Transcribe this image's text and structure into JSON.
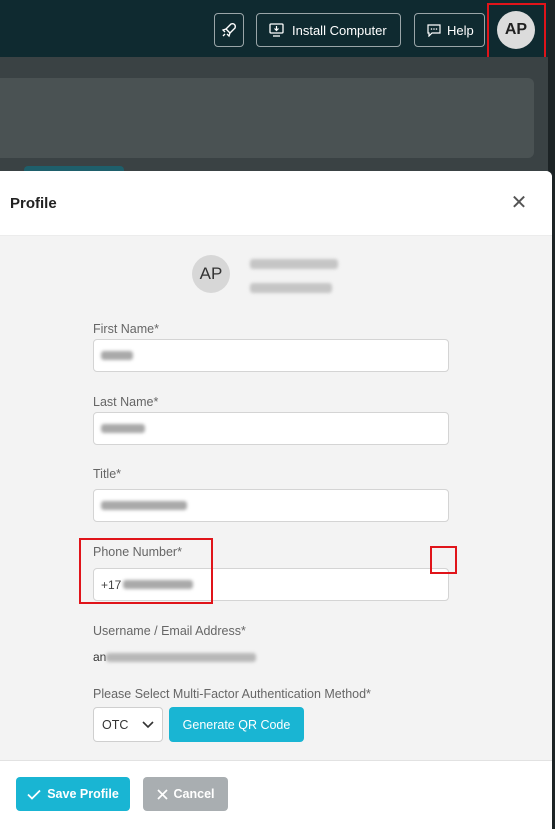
{
  "topbar": {
    "install_label": "Install Computer",
    "help_label": "Help",
    "avatar_initials": "AP",
    "icons": {
      "rocket": "rocket-icon",
      "install": "monitor-download-icon",
      "help": "chat-icon"
    }
  },
  "dialog": {
    "title": "Profile",
    "avatar_initials": "AP",
    "fields": {
      "first_name_label": "First Name*",
      "last_name_label": "Last Name*",
      "title_label": "Title*",
      "phone_label": "Phone Number*",
      "phone_value_visible": "+17",
      "username_label": "Username / Email Address*",
      "username_value_visible": "an",
      "mfa_label": "Please Select Multi-Factor Authentication Method*"
    },
    "mfa": {
      "selected": "OTC",
      "generate_label": "Generate QR Code"
    },
    "footer": {
      "save_label": "Save Profile",
      "cancel_label": "Cancel"
    }
  },
  "colors": {
    "topbar": "#0f2a30",
    "accent": "#19b5d3",
    "highlight": "#e0141a",
    "cancel": "#a9aeb1"
  }
}
